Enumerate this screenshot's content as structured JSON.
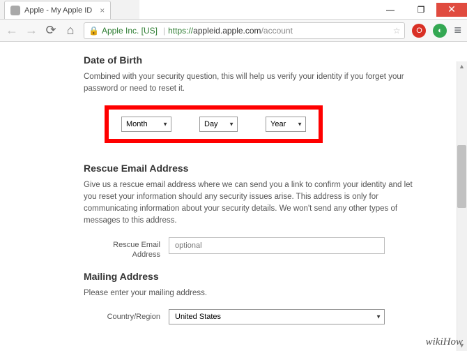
{
  "window": {
    "tab_title": "Apple - My Apple ID",
    "cert_label": "Apple Inc. [US]",
    "url_proto": "https://",
    "url_host": "appleid.apple.com",
    "url_path": "/account"
  },
  "dob": {
    "heading": "Date of Birth",
    "desc": "Combined with your security question, this will help us verify your identity if you forget your password or need to reset it.",
    "month": "Month",
    "day": "Day",
    "year": "Year"
  },
  "rescue": {
    "heading": "Rescue Email Address",
    "desc": "Give us a rescue email address where we can send you a link to confirm your identity and let you reset your information should any security issues arise. This address is only for communicating information about your security details. We won't send any other types of messages to this address.",
    "field_label": "Rescue Email Address",
    "placeholder": "optional"
  },
  "mailing": {
    "heading": "Mailing Address",
    "desc": "Please enter your mailing address.",
    "country_label": "Country/Region",
    "country_value": "United States"
  },
  "watermark": "wikiHow"
}
